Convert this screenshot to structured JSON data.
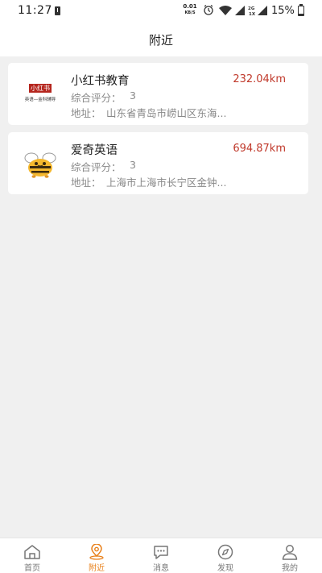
{
  "status_bar": {
    "time": "11:27",
    "net_speed_value": "0.01",
    "net_speed_unit": "KB/S",
    "battery": "15%",
    "sim_label_top": "2G",
    "sim_label_bottom": "1X"
  },
  "header": {
    "title": "附近"
  },
  "colors": {
    "accent": "#e8801a",
    "distance": "#c0392b",
    "brand_red": "#b5261e",
    "bee_yellow": "#f5b82e"
  },
  "listings": [
    {
      "name": "小红书教育",
      "distance": "232.04km",
      "score_label": "综合评分：",
      "score": "3",
      "address_label": "地址：",
      "address": "山东省青岛市崂山区东海...",
      "logo": {
        "icon": "xiaohongshu-logo",
        "brand_text": "小红书",
        "sub_text": "英语—金科辅导"
      }
    },
    {
      "name": "爱奇英语",
      "distance": "694.87km",
      "score_label": "综合评分：",
      "score": "3",
      "address_label": "地址：",
      "address": "上海市上海市长宁区金钟...",
      "logo": {
        "icon": "bee-logo"
      }
    }
  ],
  "tabbar": {
    "active": "附近",
    "tabs": [
      {
        "label": "首页",
        "icon": "home-icon"
      },
      {
        "label": "附近",
        "icon": "location-icon"
      },
      {
        "label": "消息",
        "icon": "chat-icon"
      },
      {
        "label": "发现",
        "icon": "compass-icon"
      },
      {
        "label": "我的",
        "icon": "user-icon"
      }
    ]
  }
}
